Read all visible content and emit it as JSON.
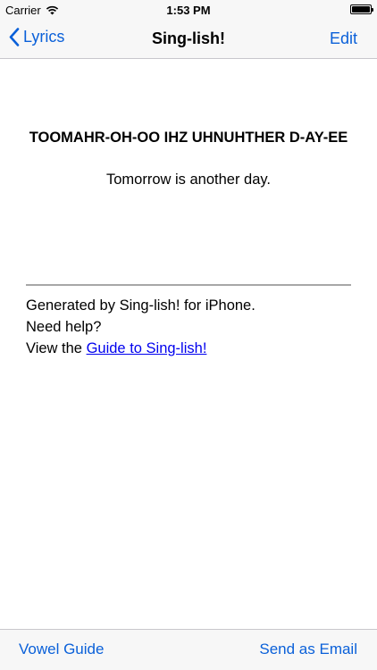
{
  "status_bar": {
    "carrier": "Carrier",
    "time": "1:53 PM"
  },
  "nav": {
    "back_label": "Lyrics",
    "title": "Sing-lish!",
    "edit_label": "Edit"
  },
  "lyric": {
    "phonetic": "TOOMAHR-OH-OO IHZ UHNUHTHER D-AY-EE",
    "original": "Tomorrow is another day."
  },
  "footer": {
    "line1": "Generated by Sing-lish! for iPhone.",
    "line2": "Need help?",
    "line3_prefix": "View the ",
    "guide_link": "Guide to Sing-lish!"
  },
  "toolbar": {
    "vowel_guide_label": "Vowel Guide",
    "send_email_label": "Send as Email"
  },
  "colors": {
    "accent": "#0a60d9",
    "link": "#0000ee",
    "bar_background": "#f7f7f7"
  },
  "icons": {
    "wifi": "wifi-icon",
    "battery": "battery-icon",
    "back": "chevron-left-icon"
  }
}
